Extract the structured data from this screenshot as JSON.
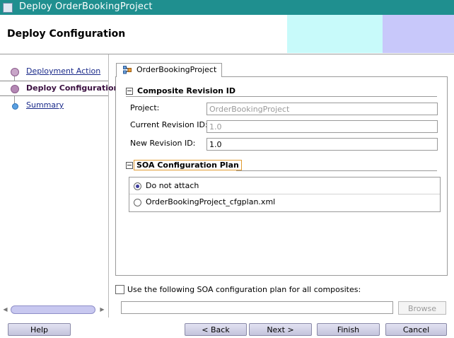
{
  "window": {
    "title": "Deploy OrderBookingProject"
  },
  "header": {
    "title": "Deploy Configuration"
  },
  "nav": {
    "items": [
      {
        "label": "Deployment Action",
        "state": "link"
      },
      {
        "label": "Deploy Configuration",
        "state": "selected"
      },
      {
        "label": "Summary",
        "state": "link"
      }
    ]
  },
  "tab": {
    "label": "OrderBookingProject"
  },
  "composite": {
    "heading": "Composite Revision ID",
    "project_label": "Project:",
    "project_value": "OrderBookingProject",
    "current_rev_label": "Current Revision ID:",
    "current_rev_value": "1.0",
    "new_rev_label": "New Revision ID:",
    "new_rev_value": "1.0"
  },
  "soa": {
    "heading": "SOA Configuration Plan",
    "options": [
      {
        "label": "Do not attach",
        "selected": true
      },
      {
        "label": "OrderBookingProject_cfgplan.xml",
        "selected": false
      }
    ]
  },
  "use_plan": {
    "label": "Use the following SOA configuration plan for all composites:",
    "checked": false,
    "path": ""
  },
  "browse_label": "Browse",
  "buttons": {
    "help": "Help",
    "back": "< Back",
    "next": "Next >",
    "finish": "Finish",
    "cancel": "Cancel"
  },
  "colors": {
    "titlebar": "#1f8f8f",
    "header_cyan": "#c8fafa",
    "header_lavender": "#c8c8fa",
    "button_fill": "#d4d4e8"
  }
}
